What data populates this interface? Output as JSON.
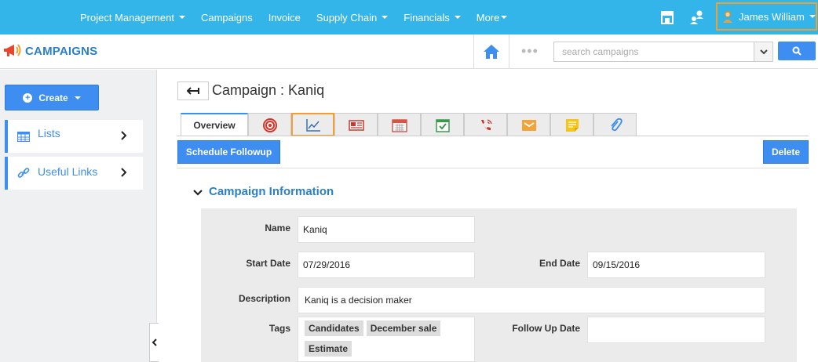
{
  "topnav": {
    "menu": [
      {
        "label": "Project Management",
        "dropdown": true
      },
      {
        "label": "Campaigns",
        "dropdown": false
      },
      {
        "label": "Invoice",
        "dropdown": false
      },
      {
        "label": "Supply Chain",
        "dropdown": true
      },
      {
        "label": "Financials",
        "dropdown": true
      },
      {
        "label": "More",
        "dropdown": true
      }
    ],
    "user_name": "James William",
    "icons": [
      "store-icon",
      "people-icon",
      "user-avatar-icon"
    ]
  },
  "subheader": {
    "title": "CAMPAIGNS",
    "search_placeholder": "search campaigns"
  },
  "sidebar": {
    "create_label": "Create",
    "items": [
      {
        "label": "Lists",
        "icon": "table-icon"
      },
      {
        "label": "Useful Links",
        "icon": "link-icon"
      }
    ]
  },
  "main": {
    "title": "Campaign : Kaniq",
    "tabs": [
      {
        "label": "Overview",
        "icon": ""
      },
      {
        "label": "",
        "icon": "target-icon"
      },
      {
        "label": "",
        "icon": "chart-icon"
      },
      {
        "label": "",
        "icon": "newspaper-icon"
      },
      {
        "label": "",
        "icon": "calendar-icon"
      },
      {
        "label": "",
        "icon": "task-check-icon"
      },
      {
        "label": "",
        "icon": "phone-icon"
      },
      {
        "label": "",
        "icon": "mail-icon"
      },
      {
        "label": "",
        "icon": "note-icon"
      },
      {
        "label": "",
        "icon": "attachment-icon"
      }
    ],
    "schedule_label": "Schedule Followup",
    "delete_label": "Delete",
    "section_title": "Campaign Information",
    "fields": {
      "name_label": "Name",
      "name_value": "Kaniq",
      "start_label": "Start Date",
      "start_value": "07/29/2016",
      "end_label": "End Date",
      "end_value": "09/15/2016",
      "desc_label": "Description",
      "desc_value": "Kaniq is a decision maker",
      "tags_label": "Tags",
      "tags": [
        "Candidates",
        "December sale",
        "Estimate"
      ],
      "followup_label": "Follow Up Date",
      "followup_value": ""
    }
  },
  "colors": {
    "topbar": "#33b5e9",
    "accent": "#3d8ef0",
    "highlight": "#f0a030"
  }
}
